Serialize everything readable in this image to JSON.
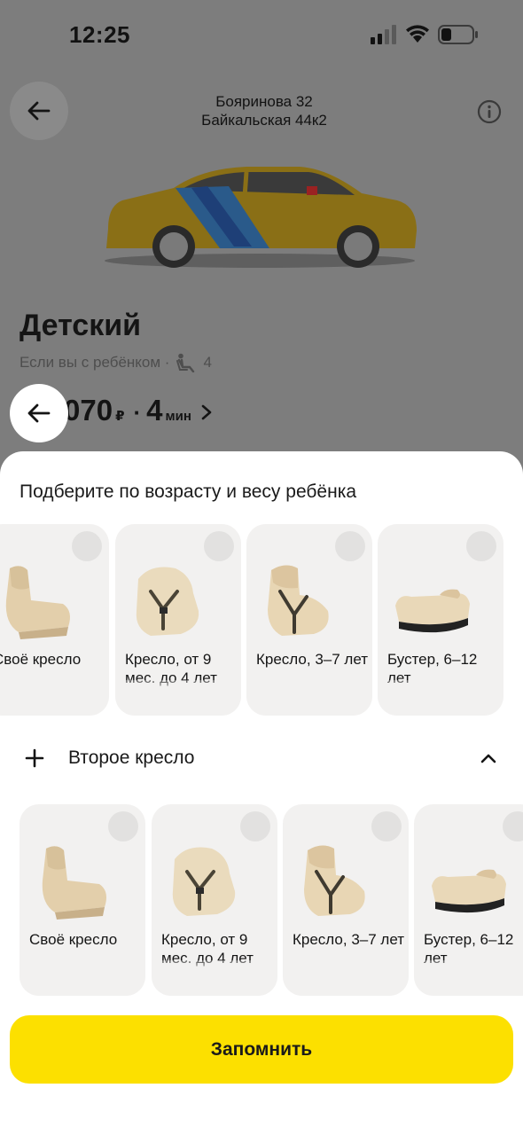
{
  "status_bar": {
    "time": "12:25"
  },
  "header": {
    "route_from": "Бояринова 32",
    "route_to": "Байкальская 44к2"
  },
  "tariff": {
    "name": "Детский",
    "subtitle": "Если вы с ребёнком ·",
    "seats": "4",
    "price": "070",
    "currency": "₽",
    "eta": "4",
    "eta_unit": "мин"
  },
  "sheet": {
    "title": "Подберите по возрасту и весу ребёнка",
    "first_row": [
      {
        "label": "Своё кресло"
      },
      {
        "label": "Кресло, от 9 мес. до 4 лет"
      },
      {
        "label": "Кресло, 3–7 лет"
      },
      {
        "label": "Бустер, 6–12 лет"
      }
    ],
    "second_seat_label": "Второе кресло",
    "second_row": [
      {
        "label": "Своё кресло"
      },
      {
        "label": "Кресло, от 9 мес. до 4 лет"
      },
      {
        "label": "Кресло, 3–7 лет"
      },
      {
        "label": "Бустер, 6–12 лет"
      }
    ],
    "cta_label": "Запомнить"
  },
  "colors": {
    "accent_yellow": "#fce000",
    "card_bg": "#f2f1f0",
    "overlay": "#7d7d7d"
  }
}
